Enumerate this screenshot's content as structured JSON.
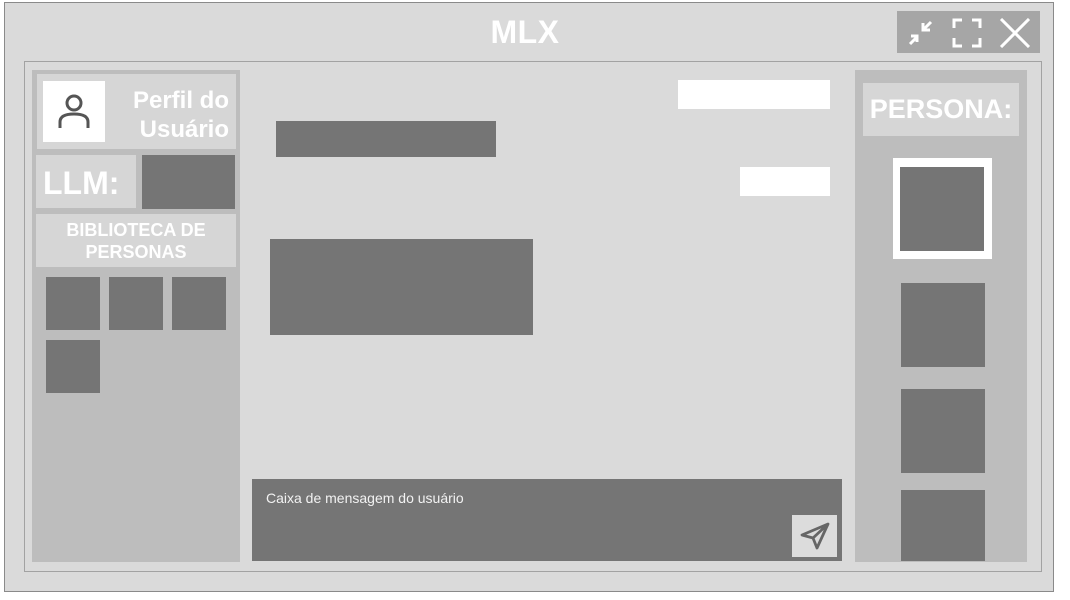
{
  "app": {
    "title": "MLX"
  },
  "window_controls": {
    "icons": [
      "shrink-icon",
      "fullscreen-icon",
      "close-icon"
    ]
  },
  "sidebar": {
    "profile": {
      "label_line1": "Perfil do",
      "label_line2": "Usuário",
      "icon": "user-icon"
    },
    "llm": {
      "label": "LLM:"
    },
    "library": {
      "label_line1": "BIBLIOTECA DE",
      "label_line2": "PERSONAS",
      "tile_count": 4
    }
  },
  "chat": {
    "messages": [
      {
        "role": "user"
      },
      {
        "role": "assistant"
      },
      {
        "role": "user"
      },
      {
        "role": "assistant"
      }
    ],
    "input": {
      "placeholder": "Caixa de mensagem do usuário"
    },
    "send": {
      "icon": "send-icon"
    }
  },
  "persona_panel": {
    "label": "PERSONA:",
    "selected_index": 0,
    "tile_count": 4
  },
  "colors": {
    "window_bg": "#dadada",
    "panel_bg": "#bdbdbd",
    "block": "#757575",
    "header_box": "#d6d6d6",
    "text_light": "#ffffff"
  }
}
